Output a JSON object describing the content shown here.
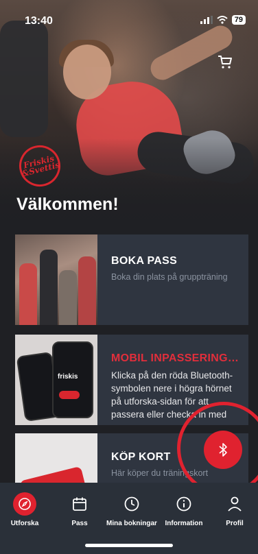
{
  "status": {
    "time": "13:40",
    "battery": "79"
  },
  "header": {
    "welcome": "Välkommen!",
    "logo_text_1": "Friskis",
    "logo_text_2": "&Svettis"
  },
  "cards": [
    {
      "title": "BOKA PASS",
      "subtitle": "Boka din plats på gruppträning"
    },
    {
      "title": "MOBIL INPASSERING/...",
      "subtitle": "Klicka på den röda Bluetooth-symbolen nere i högra hörnet på utforska-sidan för att passera eller checka in med mobilen....",
      "image_text": "friskis"
    },
    {
      "title": "KÖP KORT",
      "subtitle": "Här köper du träningskort"
    }
  ],
  "tabs": [
    {
      "label": "Utforska",
      "icon": "compass-icon"
    },
    {
      "label": "Pass",
      "icon": "calendar-icon"
    },
    {
      "label": "Mina bokningar",
      "icon": "clock-icon"
    },
    {
      "label": "Information",
      "icon": "info-icon"
    },
    {
      "label": "Profil",
      "icon": "person-icon"
    }
  ],
  "colors": {
    "accent": "#e0222f",
    "card_bg": "#2f3540",
    "tabbar_bg": "#2a3039"
  }
}
